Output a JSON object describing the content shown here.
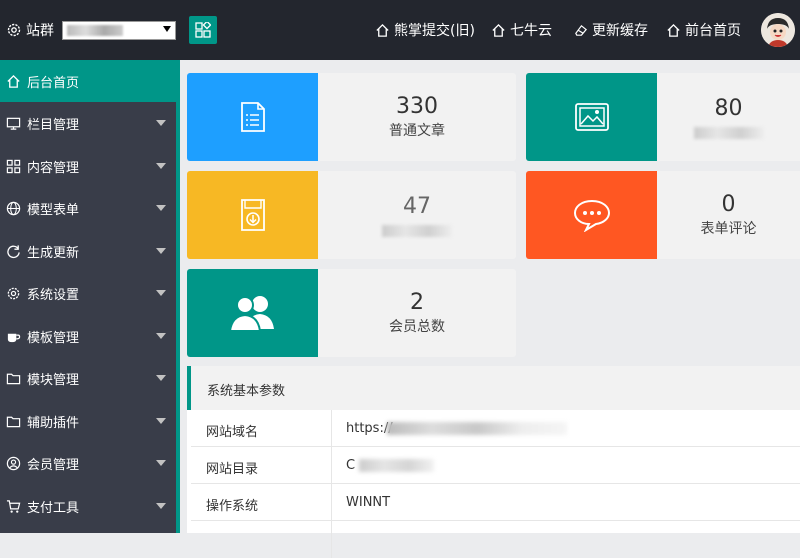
{
  "header": {
    "site_label": "站群",
    "nav": [
      {
        "label": "熊掌提交(旧)",
        "icon": "home-icon"
      },
      {
        "label": "七牛云",
        "icon": "home-icon"
      },
      {
        "label": "更新缓存",
        "icon": "eraser-icon"
      },
      {
        "label": "前台首页",
        "icon": "home-icon"
      }
    ]
  },
  "sidebar": {
    "items": [
      {
        "label": "后台首页",
        "icon": "home-icon",
        "active": true
      },
      {
        "label": "栏目管理",
        "icon": "monitor-icon"
      },
      {
        "label": "内容管理",
        "icon": "grid-icon"
      },
      {
        "label": "模型表单",
        "icon": "globe-icon"
      },
      {
        "label": "生成更新",
        "icon": "refresh-icon"
      },
      {
        "label": "系统设置",
        "icon": "gear-icon"
      },
      {
        "label": "模板管理",
        "icon": "cup-icon"
      },
      {
        "label": "模块管理",
        "icon": "folder-icon"
      },
      {
        "label": "辅助插件",
        "icon": "folder-icon"
      },
      {
        "label": "会员管理",
        "icon": "user-circle-icon"
      },
      {
        "label": "支付工具",
        "icon": "cart-icon"
      }
    ]
  },
  "cards": [
    {
      "value": "330",
      "label": "普通文章",
      "icon": "document-list-icon",
      "color": "#1e9fff"
    },
    {
      "value": "80",
      "label": "",
      "icon": "picture-icon",
      "color": "#009688"
    },
    {
      "value": "47",
      "label": "",
      "icon": "download-icon",
      "color": "#f7b824"
    },
    {
      "value": "0",
      "label": "表单评论",
      "icon": "chat-bubble-icon",
      "color": "#ff5722"
    },
    {
      "value": "2",
      "label": "会员总数",
      "icon": "users-icon",
      "color": "#009688"
    }
  ],
  "panel": {
    "title": "系统基本参数",
    "rows": [
      {
        "key": "网站域名",
        "value": "https://"
      },
      {
        "key": "网站目录",
        "value": "C"
      },
      {
        "key": "操作系统",
        "value": "WINNT"
      }
    ]
  },
  "colors": {
    "accent": "#009688",
    "topbar": "#23262e",
    "sidebar": "#393d49"
  }
}
